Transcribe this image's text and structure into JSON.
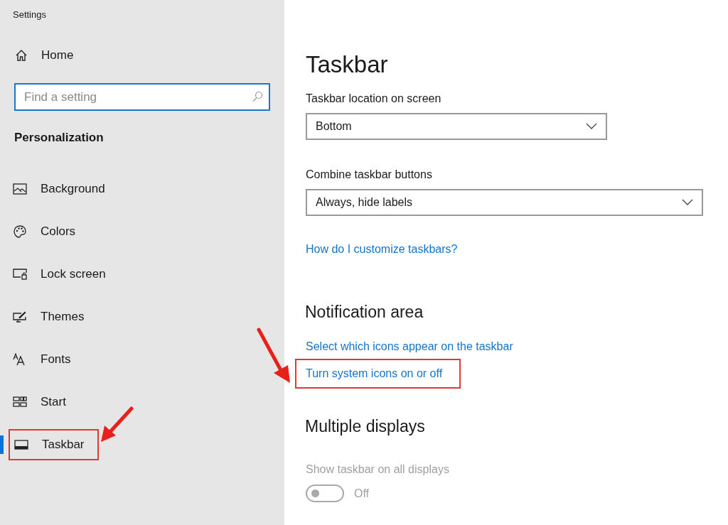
{
  "window": {
    "title": "Settings"
  },
  "sidebar": {
    "home": "Home",
    "search": {
      "placeholder": "Find a setting"
    },
    "section": "Personalization",
    "items": [
      {
        "label": "Background",
        "selected": false,
        "highlighted": false
      },
      {
        "label": "Colors",
        "selected": false,
        "highlighted": false
      },
      {
        "label": "Lock screen",
        "selected": false,
        "highlighted": false
      },
      {
        "label": "Themes",
        "selected": false,
        "highlighted": false
      },
      {
        "label": "Fonts",
        "selected": false,
        "highlighted": false
      },
      {
        "label": "Start",
        "selected": false,
        "highlighted": false
      },
      {
        "label": "Taskbar",
        "selected": true,
        "highlighted": true
      }
    ]
  },
  "main": {
    "title": "Taskbar",
    "blocks": [
      {
        "kind": "dropdown",
        "label": "Taskbar location on screen",
        "value": "Bottom",
        "wide": false
      },
      {
        "kind": "dropdown",
        "label": "Combine taskbar buttons",
        "value": "Always, hide labels",
        "wide": true
      },
      {
        "kind": "link",
        "text": "How do I customize taskbars?",
        "highlighted": false
      },
      {
        "kind": "heading",
        "text": "Notification area"
      },
      {
        "kind": "link",
        "text": "Select which icons appear on the taskbar",
        "highlighted": false
      },
      {
        "kind": "link",
        "text": "Turn system icons on or off",
        "highlighted": true
      },
      {
        "kind": "heading",
        "text": "Multiple displays"
      },
      {
        "kind": "toggle",
        "label": "Show taskbar on all displays",
        "on": false,
        "disabled": true,
        "state_text": "Off"
      }
    ]
  }
}
